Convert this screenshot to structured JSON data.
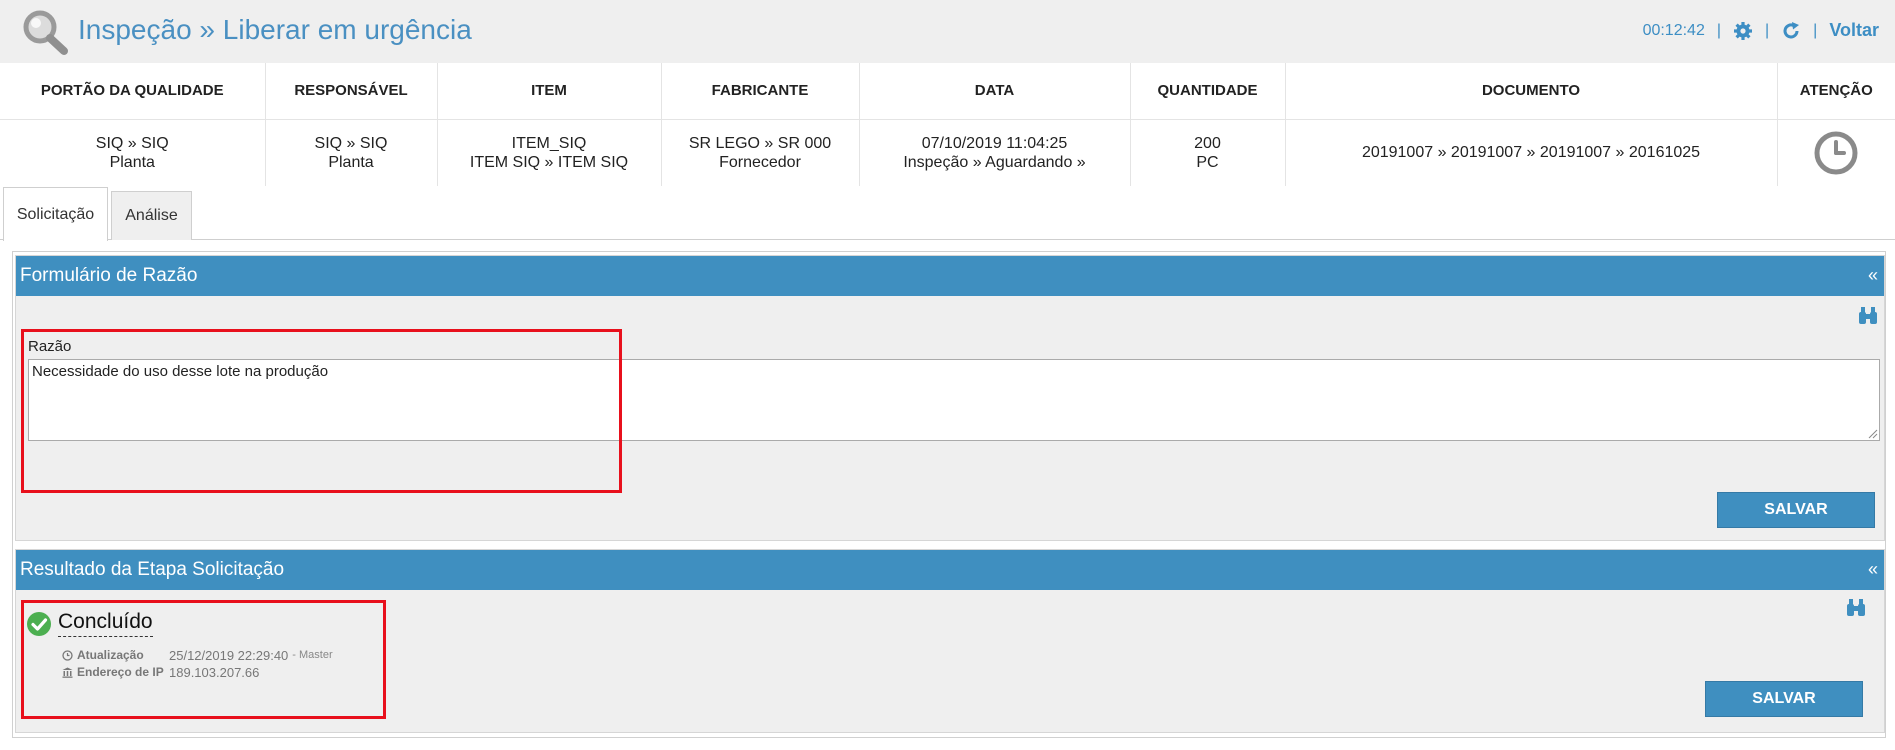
{
  "header": {
    "title": "Inspeção » Liberar em urgência",
    "timer": "00:12:42",
    "separator": "|",
    "back_label": "Voltar",
    "icons": [
      "search-icon",
      "gear-icon",
      "refresh-icon"
    ]
  },
  "info_table": {
    "columns": [
      "PORTÃO DA QUALIDADE",
      "RESPONSÁVEL",
      "ITEM",
      "FABRICANTE",
      "DATA",
      "QUANTIDADE",
      "DOCUMENTO",
      "ATENÇÃO"
    ],
    "row": {
      "portao_line1": "SIQ » SIQ",
      "portao_line2": "Planta",
      "responsavel_line1": "SIQ » SIQ",
      "responsavel_line2": "Planta",
      "item_line1": "ITEM_SIQ",
      "item_line2": "ITEM SIQ » ITEM SIQ",
      "fabricante_line1": "SR LEGO » SR 000",
      "fabricante_line2": "Fornecedor",
      "data_line1": "07/10/2019 11:04:25",
      "data_line2": "Inspeção » Aguardando »",
      "quantidade_line1": "200",
      "quantidade_line2": "PC",
      "documento": "20191007 » 20191007 » 20191007 » 20161025",
      "atencao_icon": "clock-icon"
    }
  },
  "tabs": [
    {
      "label": "Solicitação",
      "active": true
    },
    {
      "label": "Análise",
      "active": false
    }
  ],
  "form_panel": {
    "title": "Formulário de Razão",
    "collapse": "«",
    "field_label": "Razão",
    "field_value": "Necessidade do uso desse lote na produção",
    "save_label": "SALVAR"
  },
  "result_panel": {
    "title": "Resultado da Etapa Solicitação",
    "collapse": "«",
    "status": "Concluído",
    "updated_label": "Atualização",
    "updated_value": "25/12/2019 22:29:40",
    "updated_by": "- Master",
    "ip_label": "Endereço de IP",
    "ip_value": "189.103.207.66",
    "save_label": "SALVAR"
  },
  "colors": {
    "accent": "#3f8fc0",
    "title_blue": "#4a90c2",
    "highlight_red": "#e8101c",
    "success_green": "#4caf50"
  }
}
